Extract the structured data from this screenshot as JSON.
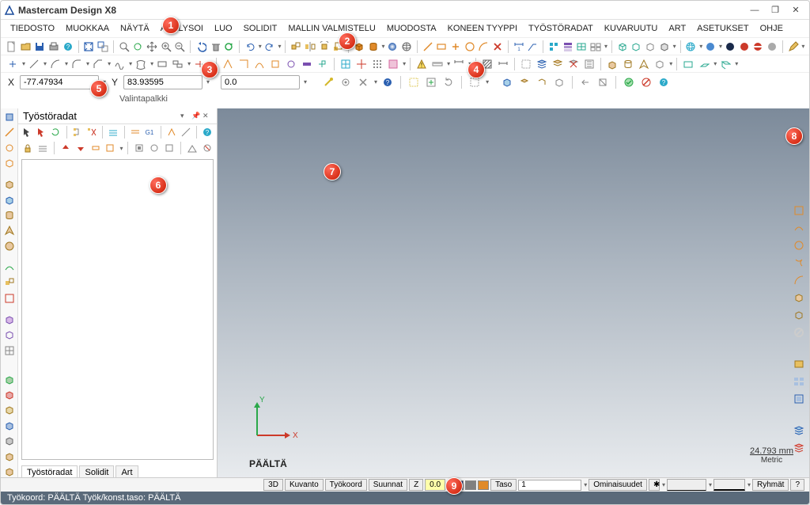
{
  "app": {
    "title": "Mastercam Design X8"
  },
  "window": {
    "min": "—",
    "max": "❐",
    "close": "✕"
  },
  "menu": [
    "TIEDOSTO",
    "MUOKKAA",
    "NÄYTÄ",
    "ANALYSOI",
    "LUO",
    "SOLIDIT",
    "MALLIN VALMISTELU",
    "MUODOSTA",
    "KONEEN TYYPPI",
    "TYÖSTÖRADAT",
    "KUVARUUTU",
    "ART",
    "ASETUKSET",
    "OHJE"
  ],
  "coords": {
    "x_label": "X",
    "x": "-77.47934",
    "y_label": "Y",
    "y": "83.93595",
    "z": "0.0"
  },
  "selbar": {
    "label": "Valintapalkki"
  },
  "ops": {
    "title": "Työstöradat",
    "pin": "▾",
    "tack": "📌",
    "close": "✕",
    "tabs": [
      "Työstöradat",
      "Solidit",
      "Art"
    ]
  },
  "viewport": {
    "axis_x": "X",
    "axis_y": "Y",
    "plane_label": "PÄÄLTÄ",
    "scale_len": "24.793 mm",
    "scale_unit": "Metric"
  },
  "bottom": {
    "btn_3d": "3D",
    "btn_kuvanto": "Kuvanto",
    "btn_tyokoord": "Työkoord",
    "btn_suunnat": "Suunnat",
    "zfield": "Z",
    "zval": "0.0",
    "taso_lbl": "Taso",
    "taso_val": "1",
    "omin": "Ominaisuudet",
    "ryhmat": "Ryhmät",
    "help": "?"
  },
  "status": {
    "text": "Työkoord: PÄÄLTÄ  Työk/konst.taso: PÄÄLTÄ"
  },
  "icons": {
    "colors": {
      "blue": "#2a5fb0",
      "cyan": "#2aa9c9",
      "green": "#2aa84a",
      "teal": "#2aa890",
      "orange": "#e08a2a",
      "red": "#cc3a2a",
      "purple": "#7a4fb0",
      "gray": "#888",
      "yellow": "#d4b82a",
      "dark": "#333",
      "pink": "#d66aa0"
    }
  }
}
